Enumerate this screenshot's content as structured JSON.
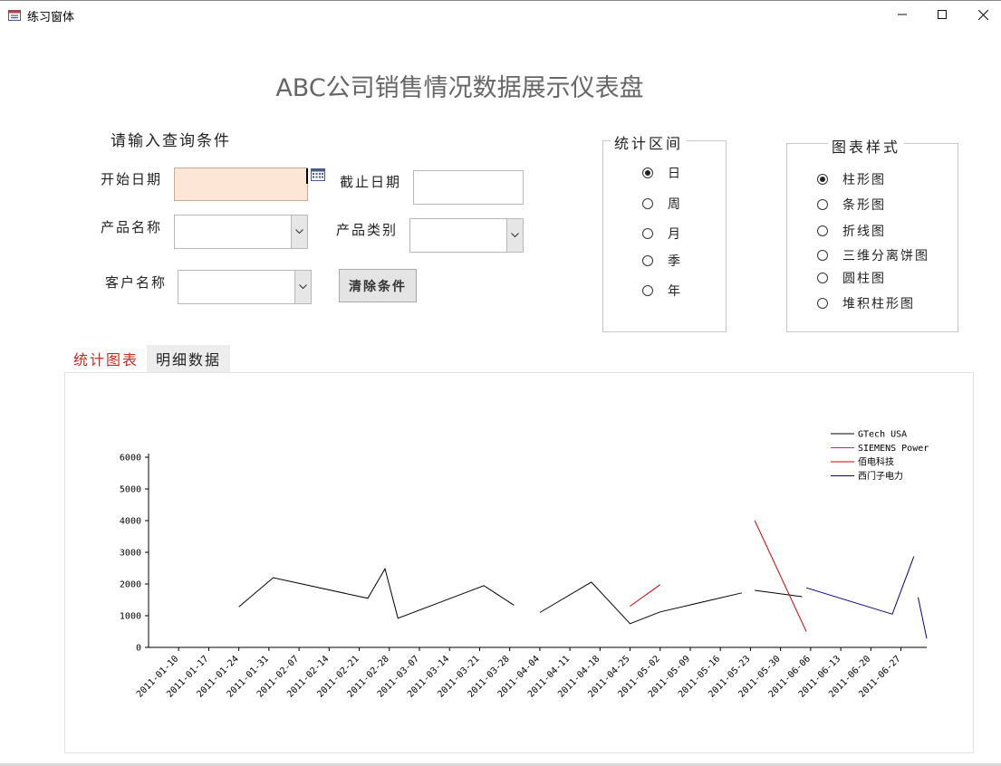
{
  "window": {
    "title": "练习窗体",
    "icon": "form-icon",
    "controls": [
      "minimize-icon",
      "maximize-icon",
      "close-icon"
    ]
  },
  "header": {
    "title": "ABC公司销售情况数据展示仪表盘"
  },
  "query": {
    "section_label": "请输入查询条件",
    "start_date_label": "开始日期",
    "start_date_value": "",
    "end_date_label": "截止日期",
    "end_date_value": "",
    "product_name_label": "产品名称",
    "product_name_value": "",
    "product_category_label": "产品类别",
    "product_category_value": "",
    "customer_name_label": "客户名称",
    "customer_name_value": "",
    "clear_button": "清除条件",
    "calendar_icon": "calendar-icon"
  },
  "interval_group": {
    "title": "统计区间",
    "options": [
      {
        "label": "日",
        "selected": true
      },
      {
        "label": "周",
        "selected": false
      },
      {
        "label": "月",
        "selected": false
      },
      {
        "label": "季",
        "selected": false
      },
      {
        "label": "年",
        "selected": false
      }
    ]
  },
  "chart_style_group": {
    "title": "图表样式",
    "options": [
      {
        "label": "柱形图",
        "selected": true
      },
      {
        "label": "条形图",
        "selected": false
      },
      {
        "label": "折线图",
        "selected": false
      },
      {
        "label": "三维分离饼图",
        "selected": false
      },
      {
        "label": "圆柱图",
        "selected": false
      },
      {
        "label": "堆积柱形图",
        "selected": false
      }
    ]
  },
  "tabs": [
    {
      "label": "统计图表",
      "active": true
    },
    {
      "label": "明细数据",
      "active": false
    }
  ],
  "chart_data": {
    "type": "line",
    "ylim": [
      0,
      6000
    ],
    "yticks": [
      0,
      1000,
      2000,
      3000,
      4000,
      5000,
      6000
    ],
    "xlim": [
      "2011-01-03",
      "2011-07-03"
    ],
    "xticks": [
      "2011-01-10",
      "2011-01-17",
      "2011-01-24",
      "2011-01-31",
      "2011-02-07",
      "2011-02-14",
      "2011-02-21",
      "2011-02-28",
      "2011-03-07",
      "2011-03-14",
      "2011-03-21",
      "2011-03-28",
      "2011-04-04",
      "2011-04-11",
      "2011-04-18",
      "2011-04-25",
      "2011-05-02",
      "2011-05-09",
      "2011-05-16",
      "2011-05-23",
      "2011-05-30",
      "2011-06-06",
      "2011-06-13",
      "2011-06-20",
      "2011-06-27"
    ],
    "legend_position": "top-right",
    "series": [
      {
        "name": "GTech USA",
        "color": "#000000",
        "segments": [
          [
            [
              "2011-01-24",
              1280
            ],
            [
              "2011-02-01",
              2200
            ],
            [
              "2011-02-23",
              1550
            ],
            [
              "2011-02-27",
              2480
            ],
            [
              "2011-03-02",
              920
            ],
            [
              "2011-03-22",
              1950
            ],
            [
              "2011-03-29",
              1330
            ]
          ],
          [
            [
              "2011-04-04",
              1100
            ],
            [
              "2011-04-16",
              2060
            ],
            [
              "2011-04-25",
              750
            ],
            [
              "2011-05-02",
              1120
            ],
            [
              "2011-05-21",
              1720
            ]
          ],
          [
            [
              "2011-05-24",
              1800
            ],
            [
              "2011-06-04",
              1600
            ]
          ]
        ]
      },
      {
        "name": "SIEMENS Power",
        "color": "#b02ab5",
        "segments": []
      },
      {
        "name": "佰电科技",
        "color": "#d40000",
        "segments": [
          [
            [
              "2011-04-25",
              1300
            ],
            [
              "2011-05-02",
              1980
            ]
          ],
          [
            [
              "2011-05-24",
              4000
            ],
            [
              "2011-06-05",
              500
            ]
          ]
        ]
      },
      {
        "name": "西门子电力",
        "color": "#000080",
        "segments": [
          [
            [
              "2011-06-05",
              1880
            ],
            [
              "2011-06-25",
              1050
            ],
            [
              "2011-06-30",
              2870
            ]
          ],
          [
            [
              "2011-07-01",
              1580
            ],
            [
              "2011-07-03",
              280
            ]
          ]
        ]
      }
    ]
  }
}
